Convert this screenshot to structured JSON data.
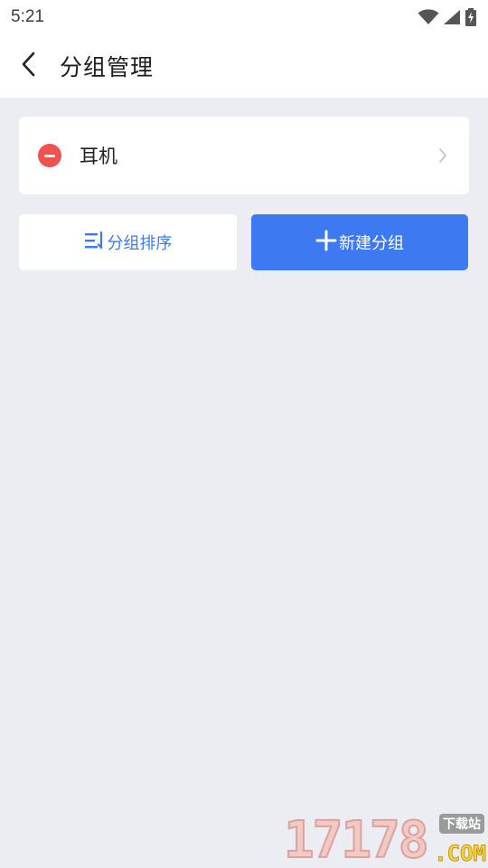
{
  "status_bar": {
    "time": "5:21",
    "icons": [
      "wifi-icon",
      "cell-signal-icon",
      "battery-charging-icon"
    ]
  },
  "header": {
    "back_icon": "chevron-left-icon",
    "title": "分组管理"
  },
  "groups": [
    {
      "name": "耳机",
      "remove_icon": "minus-circle-icon",
      "arrow_icon": "chevron-right-icon"
    }
  ],
  "actions": {
    "sort_label": "分组排序",
    "sort_icon": "sort-list-icon",
    "new_label": "新建分组",
    "new_icon": "plus-icon"
  },
  "watermark": {
    "digits": "17178",
    "tag": "下载站",
    "suffix": ".COM"
  },
  "colors": {
    "accent": "#3d7af2",
    "danger": "#ef5350",
    "background": "#ecedf2",
    "card": "#ffffff"
  }
}
